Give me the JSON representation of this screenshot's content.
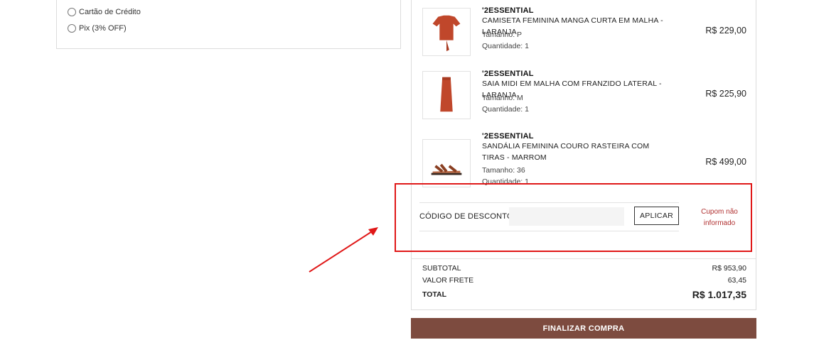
{
  "payment": {
    "options": [
      {
        "label": "Cartão de Crédito"
      },
      {
        "label": "Pix (3% OFF)"
      }
    ]
  },
  "cart": {
    "items": [
      {
        "brand": "'2ESSENTIAL",
        "name": "CAMISETA FEMININA MANGA CURTA EM MALHA - LARANJA",
        "size": "Tamanho: P",
        "quantity": "Quantidade: 1",
        "price": "R$ 229,00",
        "icon": "tshirt-icon"
      },
      {
        "brand": "'2ESSENTIAL",
        "name": "SAIA MIDI EM MALHA COM FRANZIDO LATERAL - LARANJA",
        "size": "Tamanho: M",
        "quantity": "Quantidade: 1",
        "price": "R$ 225,90",
        "icon": "skirt-icon"
      },
      {
        "brand": "'2ESSENTIAL",
        "name": "SANDÁLIA FEMININA COURO RASTEIRA COM TIRAS - MARROM",
        "size": "Tamanho: 36",
        "quantity": "Quantidade: 1",
        "price": "R$ 499,00",
        "icon": "sandal-icon"
      }
    ],
    "coupon": {
      "label": "CÓDIGO DE DESCONTO",
      "input_value": "",
      "input_placeholder": "",
      "apply_label": "APLICAR",
      "message": "Cupom não informado"
    },
    "totals": {
      "subtotal_label": "SUBTOTAL",
      "subtotal_value": "R$ 953,90",
      "shipping_label": "VALOR FRETE",
      "shipping_value": "63,45",
      "total_label": "TOTAL",
      "total_value": "R$ 1.017,35"
    },
    "finish_label": "FINALIZAR COMPRA"
  },
  "colors": {
    "accent": "#7d4b3f",
    "product": "#c0472b",
    "error": "#b03030",
    "annotation": "#e01818"
  }
}
